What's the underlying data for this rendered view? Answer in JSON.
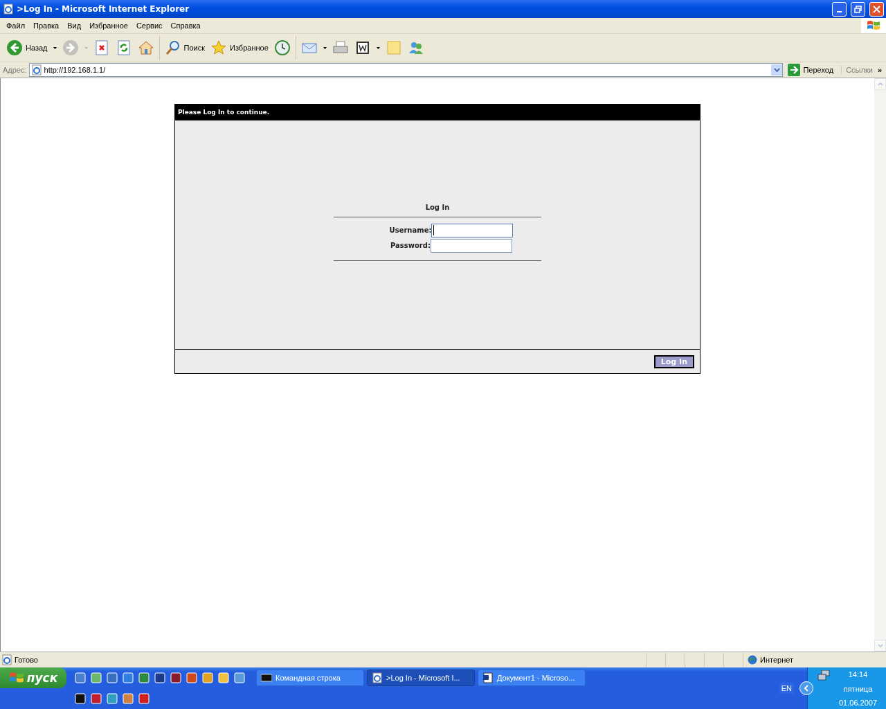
{
  "window": {
    "title": ">Log In - Microsoft Internet Explorer"
  },
  "menu": [
    "Файл",
    "Правка",
    "Вид",
    "Избранное",
    "Сервис",
    "Справка"
  ],
  "toolbar": [
    {
      "label": "Назад",
      "dropdown": true,
      "disabled": false
    },
    {
      "dropdown": true,
      "disabled": true
    },
    {
      "dropdown": false,
      "disabled": false
    },
    {
      "dropdown": false,
      "disabled": false
    },
    {
      "dropdown": false,
      "disabled": false
    },
    {
      "label": "Поиск",
      "dropdown": false,
      "disabled": false
    },
    {
      "label": "Избранное",
      "dropdown": false,
      "disabled": false
    },
    {
      "dropdown": false,
      "disabled": false
    },
    {
      "dropdown": true,
      "disabled": false
    },
    {
      "dropdown": false,
      "disabled": false
    },
    {
      "dropdown": true,
      "disabled": false
    },
    {
      "dropdown": false,
      "disabled": false
    },
    {
      "dropdown": false,
      "disabled": false
    }
  ],
  "address": {
    "label": "Адрес:",
    "value": "http://192.168.1.1/",
    "go": "Переход",
    "links": "Ссылки",
    "more": "»"
  },
  "page": {
    "header": "Please Log In to continue.",
    "heading": "Log In",
    "fields": [
      {
        "label": "Username:",
        "focused": true
      },
      {
        "label": "Password:",
        "focused": false
      }
    ],
    "button": "Log In"
  },
  "status_bar": {
    "text": "Готово",
    "zone": "Интернет"
  },
  "taskbar": {
    "start": "пуск",
    "tasks": [
      {
        "label": "Командная строка",
        "selected": false
      },
      {
        "label": ">Log In - Microsoft I...",
        "selected": true
      },
      {
        "label": "Документ1 - Microso...",
        "selected": false
      }
    ],
    "language": "EN",
    "time": "14:14",
    "day": "пятница",
    "date": "01.06.2007"
  }
}
